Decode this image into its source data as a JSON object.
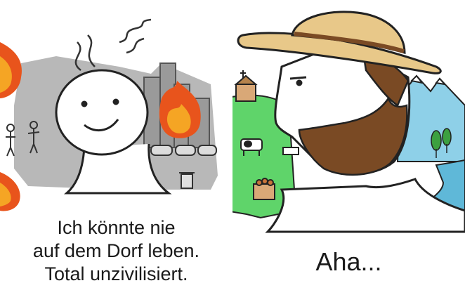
{
  "left_panel": {
    "caption_lines": [
      "Ich könnte nie",
      "auf dem Dorf leben.",
      "Total unzivilisiert."
    ]
  },
  "right_panel": {
    "caption": "Aha..."
  },
  "colors": {
    "smog_gray": "#a8a8a8",
    "fire_orange": "#f5a524",
    "fire_red": "#e8541c",
    "meadow_green": "#5fd46a",
    "lake_blue": "#5fb8d8",
    "mountain_blue": "#8ed0e8",
    "hat_straw": "#e8c889",
    "beard_brown": "#7a4a24"
  }
}
